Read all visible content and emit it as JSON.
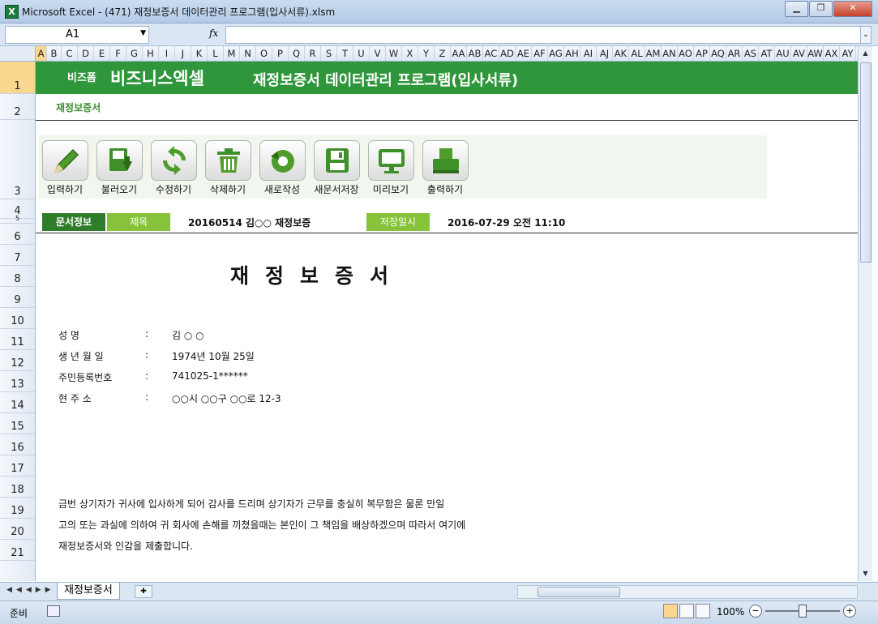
{
  "window": {
    "app_icon": "X",
    "title": "Microsoft Excel - (471) 재정보증서 데이터관리 프로그램(입사서류).xlsm",
    "buttons": [
      "▁",
      "❐",
      "✕"
    ]
  },
  "formula_bar": {
    "cell_ref": "A1",
    "fx": "fx",
    "value": ""
  },
  "columns": [
    "A",
    "B",
    "C",
    "D",
    "E",
    "F",
    "G",
    "H",
    "I",
    "J",
    "K",
    "L",
    "M",
    "N",
    "O",
    "P",
    "Q",
    "R",
    "S",
    "T",
    "U",
    "V",
    "W",
    "X",
    "Y",
    "Z",
    "AA",
    "AB",
    "AC",
    "AD",
    "AE",
    "AF",
    "AG",
    "AH",
    "AI",
    "AJ",
    "AK",
    "AL",
    "AM",
    "AN",
    "AO",
    "AP",
    "AQ",
    "AR",
    "AS",
    "AT",
    "AU",
    "AV",
    "AW",
    "AX",
    "AY",
    "A"
  ],
  "rows": [
    "1",
    "2",
    "3",
    "4",
    "5",
    "6",
    "7",
    "8",
    "9",
    "10",
    "11",
    "12",
    "13",
    "14",
    "15",
    "16",
    "17",
    "18",
    "19",
    "20",
    "21"
  ],
  "banner": {
    "brand_small": "비즈폼",
    "brand": "비즈니스엑셀",
    "title": "재정보증서 데이터관리 프로그램(입사서류)"
  },
  "subtitle": "재정보증서",
  "toolbar": [
    {
      "label": "입력하기",
      "icon": "pencil-icon"
    },
    {
      "label": "불러오기",
      "icon": "load-icon"
    },
    {
      "label": "수정하기",
      "icon": "refresh-icon"
    },
    {
      "label": "삭제하기",
      "icon": "trash-icon"
    },
    {
      "label": "새로작성",
      "icon": "new-icon"
    },
    {
      "label": "새문서저장",
      "icon": "save-icon"
    },
    {
      "label": "미리보기",
      "icon": "monitor-icon"
    },
    {
      "label": "출력하기",
      "icon": "printer-icon"
    }
  ],
  "info": {
    "doc_info_label": "문서정보",
    "title_label": "제목",
    "title_value": "20160514 김○○ 재정보증",
    "saved_label": "저장일시",
    "saved_value": "2016-07-29  오전 11:10"
  },
  "document": {
    "title": "재정보증서",
    "fields": [
      {
        "label": "성          명",
        "sep": ":",
        "value": "김 ○ ○"
      },
      {
        "label": "생 년 월 일",
        "sep": ":",
        "value": "1974년 10월 25일"
      },
      {
        "label": "주민등록번호",
        "sep": ":",
        "value": "741025-1******"
      },
      {
        "label": "현    주    소",
        "sep": ":",
        "value": "○○시 ○○구 ○○로 12-3"
      }
    ],
    "paragraph": [
      "   금번 상기자가 귀사에 입사하게 되어 감사를 드리며 상기자가 근무를 충실히 복무함은 물론 만일",
      "고의 또는 과실에 의하여 귀 회사에 손해를 끼쳤을때는 본인이 그 책임을 배상하겠으며 따라서 여기에",
      "재정보증서와 인감을 제출합니다."
    ]
  },
  "sheet_tab": "재정보증서",
  "tab_nav": "◀◀◀▶▶",
  "status": {
    "ready": "준비",
    "zoom": "100%",
    "zoom_minus": "−",
    "zoom_plus": "+"
  }
}
